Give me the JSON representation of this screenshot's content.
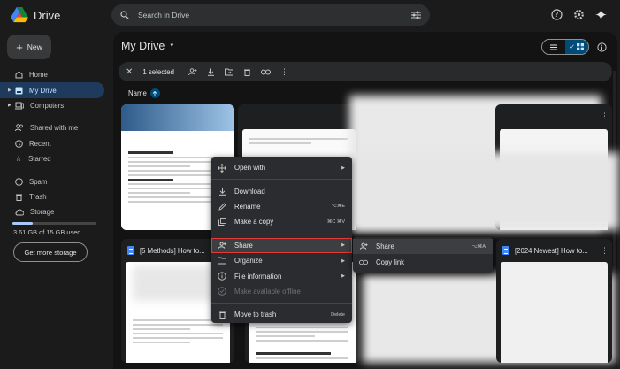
{
  "app": {
    "name": "Drive"
  },
  "search": {
    "placeholder": "Search in Drive"
  },
  "sidebar": {
    "new_label": "New",
    "items": [
      {
        "label": "Home"
      },
      {
        "label": "My Drive"
      },
      {
        "label": "Computers"
      },
      {
        "label": "Shared with me"
      },
      {
        "label": "Recent"
      },
      {
        "label": "Starred"
      },
      {
        "label": "Spam"
      },
      {
        "label": "Trash"
      },
      {
        "label": "Storage"
      }
    ],
    "storage_text": "3.61 GB of 15 GB used",
    "storage_fraction": 0.24,
    "get_storage_label": "Get more storage"
  },
  "main": {
    "title": "My Drive",
    "selection_text": "1 selected",
    "sort_label": "Name"
  },
  "cards": [
    {
      "title": "[5 Methods] How to..."
    },
    {
      "title": "[2024 Newest] How to..."
    }
  ],
  "context_menu": {
    "items": [
      {
        "label": "Open with"
      },
      {
        "label": "Download"
      },
      {
        "label": "Rename",
        "shortcut": "⌥⌘E"
      },
      {
        "label": "Make a copy",
        "shortcut": "⌘C ⌘V"
      },
      {
        "label": "Share"
      },
      {
        "label": "Organize"
      },
      {
        "label": "File information"
      },
      {
        "label": "Make available offline"
      },
      {
        "label": "Move to trash",
        "shortcut": "Delete"
      }
    ]
  },
  "submenu": {
    "items": [
      {
        "label": "Share",
        "shortcut": "⌥⌘A"
      },
      {
        "label": "Copy link"
      }
    ]
  },
  "colors": {
    "accent": "#004a77",
    "highlight_border": "#e53935",
    "link": "#a8c7fa"
  }
}
